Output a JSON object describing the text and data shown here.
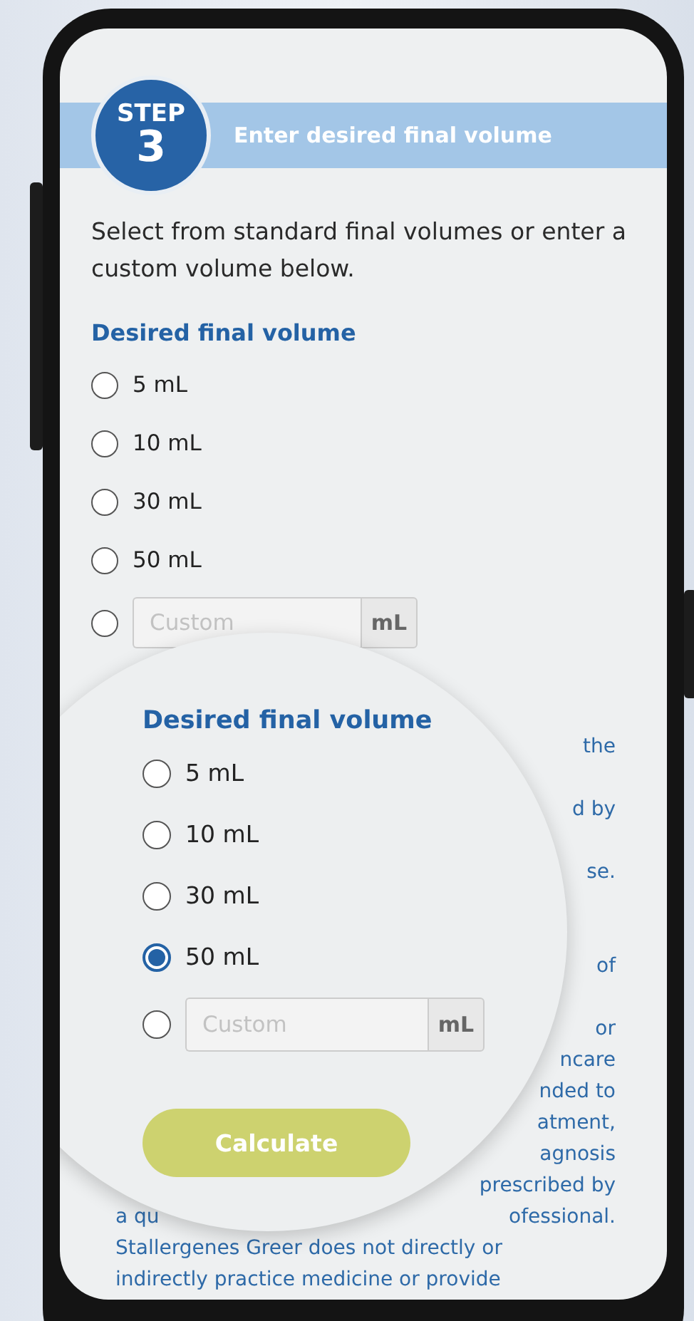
{
  "step": {
    "label": "STEP",
    "number": "3",
    "title": "Enter desired final volume"
  },
  "description": "Select from standard final volumes or enter a custom volume below.",
  "volume_group": {
    "heading": "Desired final volume",
    "options": [
      {
        "label": "5 mL",
        "selected": false
      },
      {
        "label": "10 mL",
        "selected": false
      },
      {
        "label": "30 mL",
        "selected": false
      },
      {
        "label": "50 mL",
        "selected": false
      }
    ],
    "custom": {
      "selected": false,
      "placeholder": "Custom",
      "unit": "mL"
    }
  },
  "disclaimer_lines": [
    {
      "right": "the"
    },
    {
      "right": "d by"
    },
    {
      "right": "se."
    },
    {
      "right": "of"
    },
    {
      "right": "or"
    },
    {
      "right": "ncare"
    },
    {
      "right": "nded to"
    },
    {
      "right": "atment,"
    },
    {
      "right": "agnosis"
    },
    {
      "right": "prescribed by"
    },
    {
      "left": "a qu",
      "right": "ofessional."
    },
    {
      "left": "Stallergenes Greer does not directly or"
    },
    {
      "left": "indirectly practice medicine or provide"
    }
  ],
  "magnifier": {
    "heading": "Desired final volume",
    "options": [
      {
        "label": "5 mL",
        "selected": false
      },
      {
        "label": "10 mL",
        "selected": false
      },
      {
        "label": "30 mL",
        "selected": false
      },
      {
        "label": "50 mL",
        "selected": true
      }
    ],
    "custom": {
      "selected": false,
      "placeholder": "Custom",
      "unit": "mL"
    },
    "button": "Calculate"
  }
}
